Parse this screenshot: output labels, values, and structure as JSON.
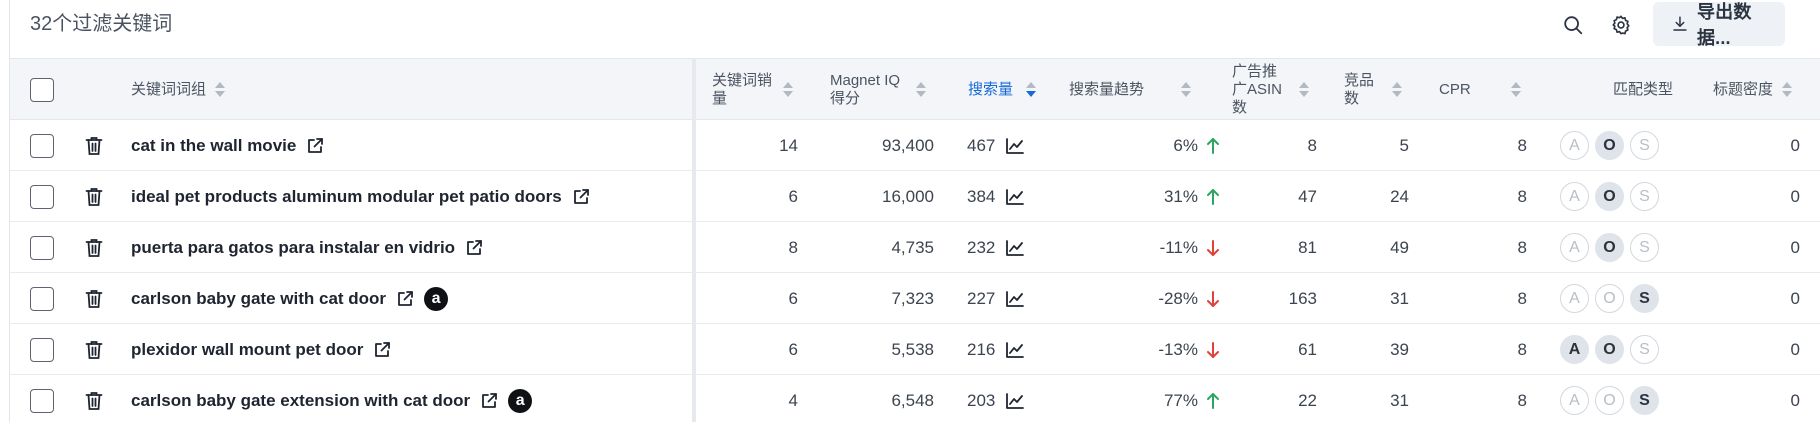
{
  "header": {
    "count_title": "32个过滤关键词",
    "export_label": "导出数据..."
  },
  "columns": {
    "keyword_group": "关键词词组",
    "keyword_sales_l1": "关键词销",
    "keyword_sales_l2": "量",
    "magnet_iq_l1": "Magnet IQ",
    "magnet_iq_l2": "得分",
    "search_volume": "搜索量",
    "search_trend": "搜索量趋势",
    "sponsored_asins_l1": "广告推",
    "sponsored_asins_l2": "广ASIN",
    "sponsored_asins_l3": "数",
    "competing_l1": "竞品",
    "competing_l2": "数",
    "cpr": "CPR",
    "match_type": "匹配类型",
    "title_density": "标题密度"
  },
  "rows": [
    {
      "keyword": "cat in the wall movie",
      "amazon": false,
      "sales": "14",
      "iq": "93,400",
      "volume": "467",
      "trend": "6%",
      "trend_dir": "up",
      "asins": "8",
      "competing": "5",
      "cpr": "8",
      "match": [
        "A",
        "O",
        "S"
      ],
      "match_on": [
        false,
        true,
        false
      ],
      "density": "0"
    },
    {
      "keyword": "ideal pet products aluminum modular pet patio doors",
      "amazon": false,
      "sales": "6",
      "iq": "16,000",
      "volume": "384",
      "trend": "31%",
      "trend_dir": "up",
      "asins": "47",
      "competing": "24",
      "cpr": "8",
      "match": [
        "A",
        "O",
        "S"
      ],
      "match_on": [
        false,
        true,
        false
      ],
      "density": "0"
    },
    {
      "keyword": "puerta para gatos para instalar en vidrio",
      "amazon": false,
      "sales": "8",
      "iq": "4,735",
      "volume": "232",
      "trend": "-11%",
      "trend_dir": "down",
      "asins": "81",
      "competing": "49",
      "cpr": "8",
      "match": [
        "A",
        "O",
        "S"
      ],
      "match_on": [
        false,
        true,
        false
      ],
      "density": "0"
    },
    {
      "keyword": "carlson baby gate with cat door",
      "amazon": true,
      "sales": "6",
      "iq": "7,323",
      "volume": "227",
      "trend": "-28%",
      "trend_dir": "down",
      "asins": "163",
      "competing": "31",
      "cpr": "8",
      "match": [
        "A",
        "O",
        "S"
      ],
      "match_on": [
        false,
        false,
        true
      ],
      "density": "0"
    },
    {
      "keyword": "plexidor wall mount pet door",
      "amazon": false,
      "sales": "6",
      "iq": "5,538",
      "volume": "216",
      "trend": "-13%",
      "trend_dir": "down",
      "asins": "61",
      "competing": "39",
      "cpr": "8",
      "match": [
        "A",
        "O",
        "S"
      ],
      "match_on": [
        true,
        true,
        false
      ],
      "density": "0"
    },
    {
      "keyword": "carlson baby gate extension with cat door",
      "amazon": true,
      "sales": "4",
      "iq": "6,548",
      "volume": "203",
      "trend": "77%",
      "trend_dir": "up",
      "asins": "22",
      "competing": "31",
      "cpr": "8",
      "match": [
        "A",
        "O",
        "S"
      ],
      "match_on": [
        false,
        false,
        true
      ],
      "density": "0"
    }
  ],
  "amazon_badge": "a",
  "colors": {
    "accent": "#1769d8",
    "trend_up": "#2aa660",
    "trend_down": "#e0413a"
  }
}
